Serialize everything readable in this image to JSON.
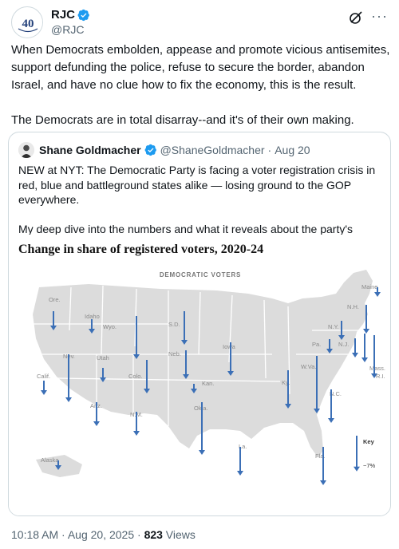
{
  "author": {
    "name": "RJC",
    "handle": "@RJC",
    "avatar_text": "40"
  },
  "tweet": {
    "paragraphs": [
      "When Democrats embolden, appease and promote vicious antisemites, support defunding the police, refuse to secure the border, abandon Israel, and have no clue how to fix the economy, this is the result.",
      "The Democrats are in total disarray--and it's of their own making."
    ]
  },
  "quote": {
    "name": "Shane Goldmacher",
    "handle": "@ShaneGoldmacher",
    "separator": "·",
    "date": "Aug 20",
    "paragraphs": [
      "NEW at NYT: The Democratic Party is facing a voter registration crisis in red, blue and battleground states alike — losing ground to the GOP everywhere.",
      "My deep dive into the numbers and what it reveals about the party's brand.",
      "..."
    ]
  },
  "footer": {
    "time": "10:18 AM · Aug 20, 2025 · ",
    "views_count": "823",
    "views_label": " Views"
  },
  "colors": {
    "arrow": "#3b6fb6",
    "state": "#dcdcdc",
    "border": "#ffffff",
    "verified": "#1d9bf0"
  },
  "icons": {
    "verified": "verified-badge-icon",
    "grok": "grok-icon",
    "more": "more-icon"
  },
  "chart_data": {
    "type": "map",
    "title": "Change in share of registered voters, 2020-24",
    "subtitle": "DEMOCRATIC VOTERS",
    "legend": {
      "label": "Key",
      "value_label": "−7%",
      "value": -7
    },
    "series": [
      {
        "state": "Ore.",
        "value": -2
      },
      {
        "state": "Idaho",
        "value": -1.5
      },
      {
        "state": "Wyo.",
        "value": -4.5
      },
      {
        "state": "S.D.",
        "value": -3.5
      },
      {
        "state": "Nev.",
        "value": -5
      },
      {
        "state": "Utah",
        "value": -1.5
      },
      {
        "state": "Calif.",
        "value": -1.5
      },
      {
        "state": "Colo.",
        "value": -3.5
      },
      {
        "state": "Neb.",
        "value": -3
      },
      {
        "state": "Iowa",
        "value": -3.5
      },
      {
        "state": "Kan.",
        "value": -1
      },
      {
        "state": "Ariz.",
        "value": -2.5
      },
      {
        "state": "N.M.",
        "value": -2.5
      },
      {
        "state": "Okla.",
        "value": -5.5
      },
      {
        "state": "Alaska",
        "value": -1
      },
      {
        "state": "La.",
        "value": -3
      },
      {
        "state": "Ky.",
        "value": -4
      },
      {
        "state": "W.Va.",
        "value": -6
      },
      {
        "state": "Pa.",
        "value": -1.5
      },
      {
        "state": "N.C.",
        "value": -3.5
      },
      {
        "state": "Fla.",
        "value": -4
      },
      {
        "state": "N.Y.",
        "value": -2
      },
      {
        "state": "N.J.",
        "value": -2
      },
      {
        "state": "Mass.",
        "value": -4.5
      },
      {
        "state": "R.I.",
        "value": -3
      },
      {
        "state": "N.H.",
        "value": -3
      },
      {
        "state": "Maine",
        "value": -1
      }
    ]
  }
}
